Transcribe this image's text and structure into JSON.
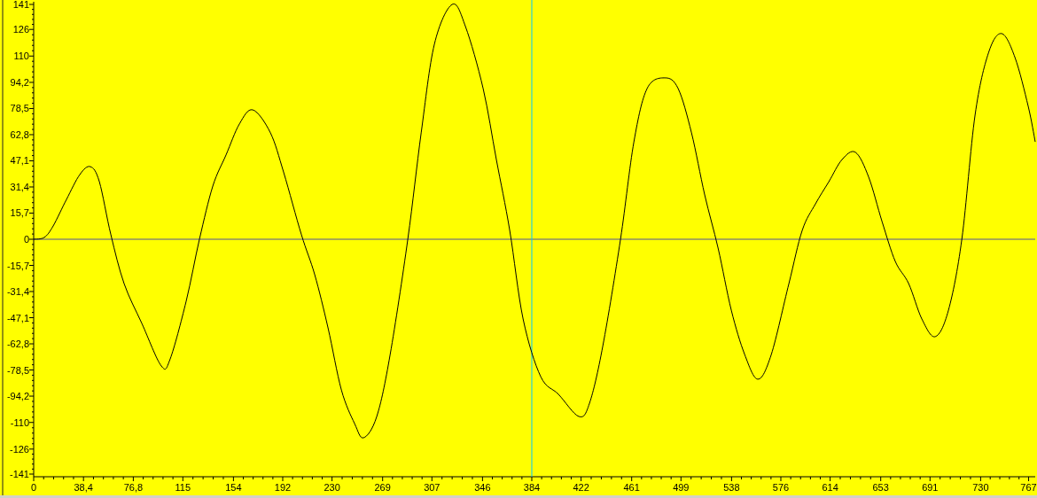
{
  "chart_data": {
    "type": "line",
    "x": [
      0,
      8.2,
      15,
      25.3,
      35.5,
      43.7,
      50.6,
      59.5,
      69.7,
      83.4,
      98.4,
      105.2,
      117.5,
      127.8,
      138.1,
      148.3,
      158.6,
      168.9,
      182.5,
      192.8,
      206.4,
      216.7,
      226.9,
      237.2,
      247.4,
      254.3,
      264.5,
      274.8,
      288.4,
      298.7,
      308.9,
      322.6,
      332.9,
      346.5,
      356.7,
      367,
      377.3,
      390.9,
      404.6,
      420.3,
      428.5,
      438.8,
      452.4,
      462.7,
      472.9,
      486.6,
      496.8,
      507.1,
      517.3,
      527.6,
      537.8,
      548.1,
      558.3,
      568.6,
      582.2,
      592.5,
      602.7,
      613,
      623.2,
      633.5,
      643.7,
      654,
      664.2,
      674.5,
      684.7,
      695,
      705.2,
      715.5,
      725.7,
      736,
      746.2,
      756.5,
      766.7,
      772.1
    ],
    "series": [
      {
        "color": "#000000",
        "values": [
          0,
          1.1,
          8,
          23.9,
          38.8,
          43.6,
          34.6,
          2.7,
          -26.6,
          -50.6,
          -76.1,
          -71.9,
          -37.3,
          0,
          31.9,
          50.6,
          69.2,
          77.7,
          63.9,
          39.9,
          2.7,
          -21.3,
          -53.2,
          -90.5,
          -110.7,
          -119.2,
          -106.4,
          -69.2,
          0,
          63.9,
          117.1,
          141,
          127.7,
          90.5,
          47.9,
          5.3,
          -47.9,
          -82.5,
          -93.1,
          -106.4,
          -98.5,
          -63.9,
          0,
          58.5,
          90.5,
          96.9,
          90.5,
          63.9,
          26.6,
          -5.3,
          -42.6,
          -69.2,
          -84,
          -69.2,
          -26.6,
          5.3,
          21.3,
          34.6,
          47.9,
          52.2,
          37.3,
          10.6,
          -13.3,
          -26.6,
          -47.9,
          -58.5,
          -42.6,
          0,
          74.5,
          111.8,
          123.5,
          109.1,
          79.8,
          58.5
        ]
      }
    ],
    "xlim": [
      0,
      772.1
    ],
    "ylim": [
      -141,
      141
    ],
    "xticks": [
      0,
      {
        "value": 38.4,
        "label": "38,4"
      },
      {
        "value": 76.8,
        "label": "76,8"
      },
      115,
      154,
      192,
      230,
      269,
      307,
      346,
      384,
      422,
      461,
      499,
      538,
      576,
      614,
      653,
      691,
      730,
      767
    ],
    "yticks": [
      141,
      126,
      110,
      {
        "value": 94.2,
        "label": "94,2"
      },
      {
        "value": 78.5,
        "label": "78,5"
      },
      {
        "value": 62.8,
        "label": "62,8"
      },
      {
        "value": 47.1,
        "label": "47,1"
      },
      {
        "value": 31.4,
        "label": "31,4"
      },
      {
        "value": 15.7,
        "label": "15,7"
      },
      0,
      {
        "value": -15.7,
        "label": "-15,7"
      },
      {
        "value": -31.4,
        "label": "-31,4"
      },
      {
        "value": -47.1,
        "label": "-47,1"
      },
      {
        "value": -62.8,
        "label": "-62,8"
      },
      {
        "value": -78.5,
        "label": "-78,5"
      },
      {
        "value": -94.2,
        "label": "-94,2"
      },
      -110,
      -126,
      -141
    ],
    "ref_lines": [
      {
        "axis": "y",
        "value": 0,
        "color": "#5050a0"
      },
      {
        "axis": "x",
        "value": 384,
        "color": "#00c8ff"
      }
    ]
  }
}
